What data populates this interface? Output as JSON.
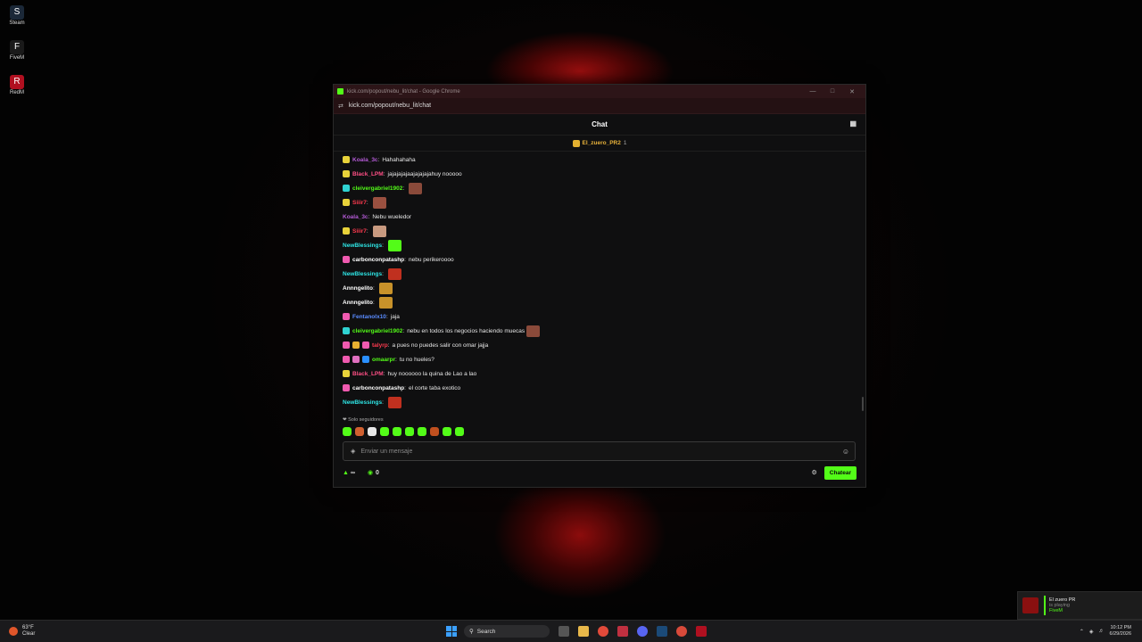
{
  "desktop": {
    "icons": [
      {
        "label": "Steam",
        "color": "#1b2838",
        "glyph": "S"
      },
      {
        "label": "FiveM",
        "color": "#1a1a1a",
        "glyph": "F"
      },
      {
        "label": "RedM",
        "color": "#b01020",
        "glyph": "R"
      }
    ]
  },
  "browser": {
    "window_title": "kick.com/popout/nebu_lit/chat - Google Chrome",
    "url": "kick.com/popout/nebu_lit/chat"
  },
  "chat": {
    "header_title": "Chat",
    "pinned_user": "El_zuero_PR2",
    "pinned_count": "1",
    "messages": [
      {
        "badges": [
          "#e8d23a"
        ],
        "user": "Koala_3c",
        "user_color": "#b45bd6",
        "text": "Hahahahaha",
        "emotes": []
      },
      {
        "badges": [
          "#e8d23a"
        ],
        "user": "Black_LPM",
        "user_color": "#ff4f86",
        "text": "jajajajajaajajajajahuy nooooo",
        "emotes": []
      },
      {
        "badges": [
          "#2fd2d2"
        ],
        "user": "cleivergabriel1902",
        "user_color": "#53fc18",
        "text": "",
        "emotes": [
          "#8a4a3a"
        ]
      },
      {
        "badges": [
          "#e8d23a"
        ],
        "user": "Siiir7",
        "user_color": "#ff3a4f",
        "text": "",
        "emotes": [
          "#9a5040"
        ]
      },
      {
        "badges": [],
        "user": "Koala_3c",
        "user_color": "#b45bd6",
        "text": "Nebu wueledor",
        "emotes": []
      },
      {
        "badges": [
          "#e8d23a"
        ],
        "user": "Siiir7",
        "user_color": "#ff3a4f",
        "text": "",
        "emotes": [
          "#c89a80"
        ]
      },
      {
        "badges": [],
        "user": "NewBlessings",
        "user_color": "#2ee6e6",
        "text": "",
        "emotes": [
          "#53fc18"
        ]
      },
      {
        "badges": [
          "#f05ab0"
        ],
        "user": "carbonconpatashp",
        "user_color": "#ffffff",
        "text": "nebu perikeroooo",
        "emotes": []
      },
      {
        "badges": [],
        "user": "NewBlessings",
        "user_color": "#2ee6e6",
        "text": "",
        "emotes": [
          "#c0301f"
        ]
      },
      {
        "badges": [],
        "user": "Annngelito",
        "user_color": "#ffffff",
        "text": "",
        "emotes": [
          "#c8922a"
        ]
      },
      {
        "badges": [],
        "user": "Annngelito",
        "user_color": "#ffffff",
        "text": "",
        "emotes": [
          "#c8922a"
        ]
      },
      {
        "badges": [
          "#f05ab0"
        ],
        "user": "Fentanolx10",
        "user_color": "#5a8cff",
        "text": "jaja",
        "emotes": []
      },
      {
        "badges": [
          "#2fd2d2"
        ],
        "user": "cleivergabriel1902",
        "user_color": "#53fc18",
        "text": "nebu en todos los negocios haciendo muecas",
        "emotes": [
          "#8a4a3a"
        ]
      },
      {
        "badges": [
          "#f05ab0",
          "#e8b030",
          "#f05ab0"
        ],
        "user": "talyrp",
        "user_color": "#ff3a4f",
        "text": "a pues no puedes salir con omar jajja",
        "emotes": []
      },
      {
        "badges": [
          "#f05ab0",
          "#e070c0",
          "#2a90ff"
        ],
        "user": "omaarpr",
        "user_color": "#53fc18",
        "text": "tu no hueles?",
        "emotes": []
      },
      {
        "badges": [
          "#e8d23a"
        ],
        "user": "Black_LPM",
        "user_color": "#ff4f86",
        "text": "huy noooooo la quina de Lao a lao",
        "emotes": []
      },
      {
        "badges": [
          "#f05ab0"
        ],
        "user": "carbonconpatashp",
        "user_color": "#ffffff",
        "text": "el corte taba exotico",
        "emotes": []
      },
      {
        "badges": [],
        "user": "NewBlessings",
        "user_color": "#2ee6e6",
        "text": "",
        "emotes": [
          "#c0301f"
        ]
      }
    ],
    "followers_only": "Solo seguidores",
    "emote_bar": [
      "#53fc18",
      "#d06030",
      "#e8e8e8",
      "#53fc18",
      "#53fc18",
      "#53fc18",
      "#53fc18",
      "#c0501f",
      "#53fc18",
      "#53fc18"
    ],
    "input_placeholder": "Enviar un mensaje",
    "points_value": "∞",
    "coins_value": "0",
    "send_label": "Chatear"
  },
  "notification": {
    "name": "El zuero PR",
    "status": "is playing",
    "game": "FiveM"
  },
  "taskbar": {
    "temperature": "63°F",
    "condition": "Clear",
    "search_label": "Search",
    "time": "10:12 PM",
    "date": "6/29/2026"
  }
}
